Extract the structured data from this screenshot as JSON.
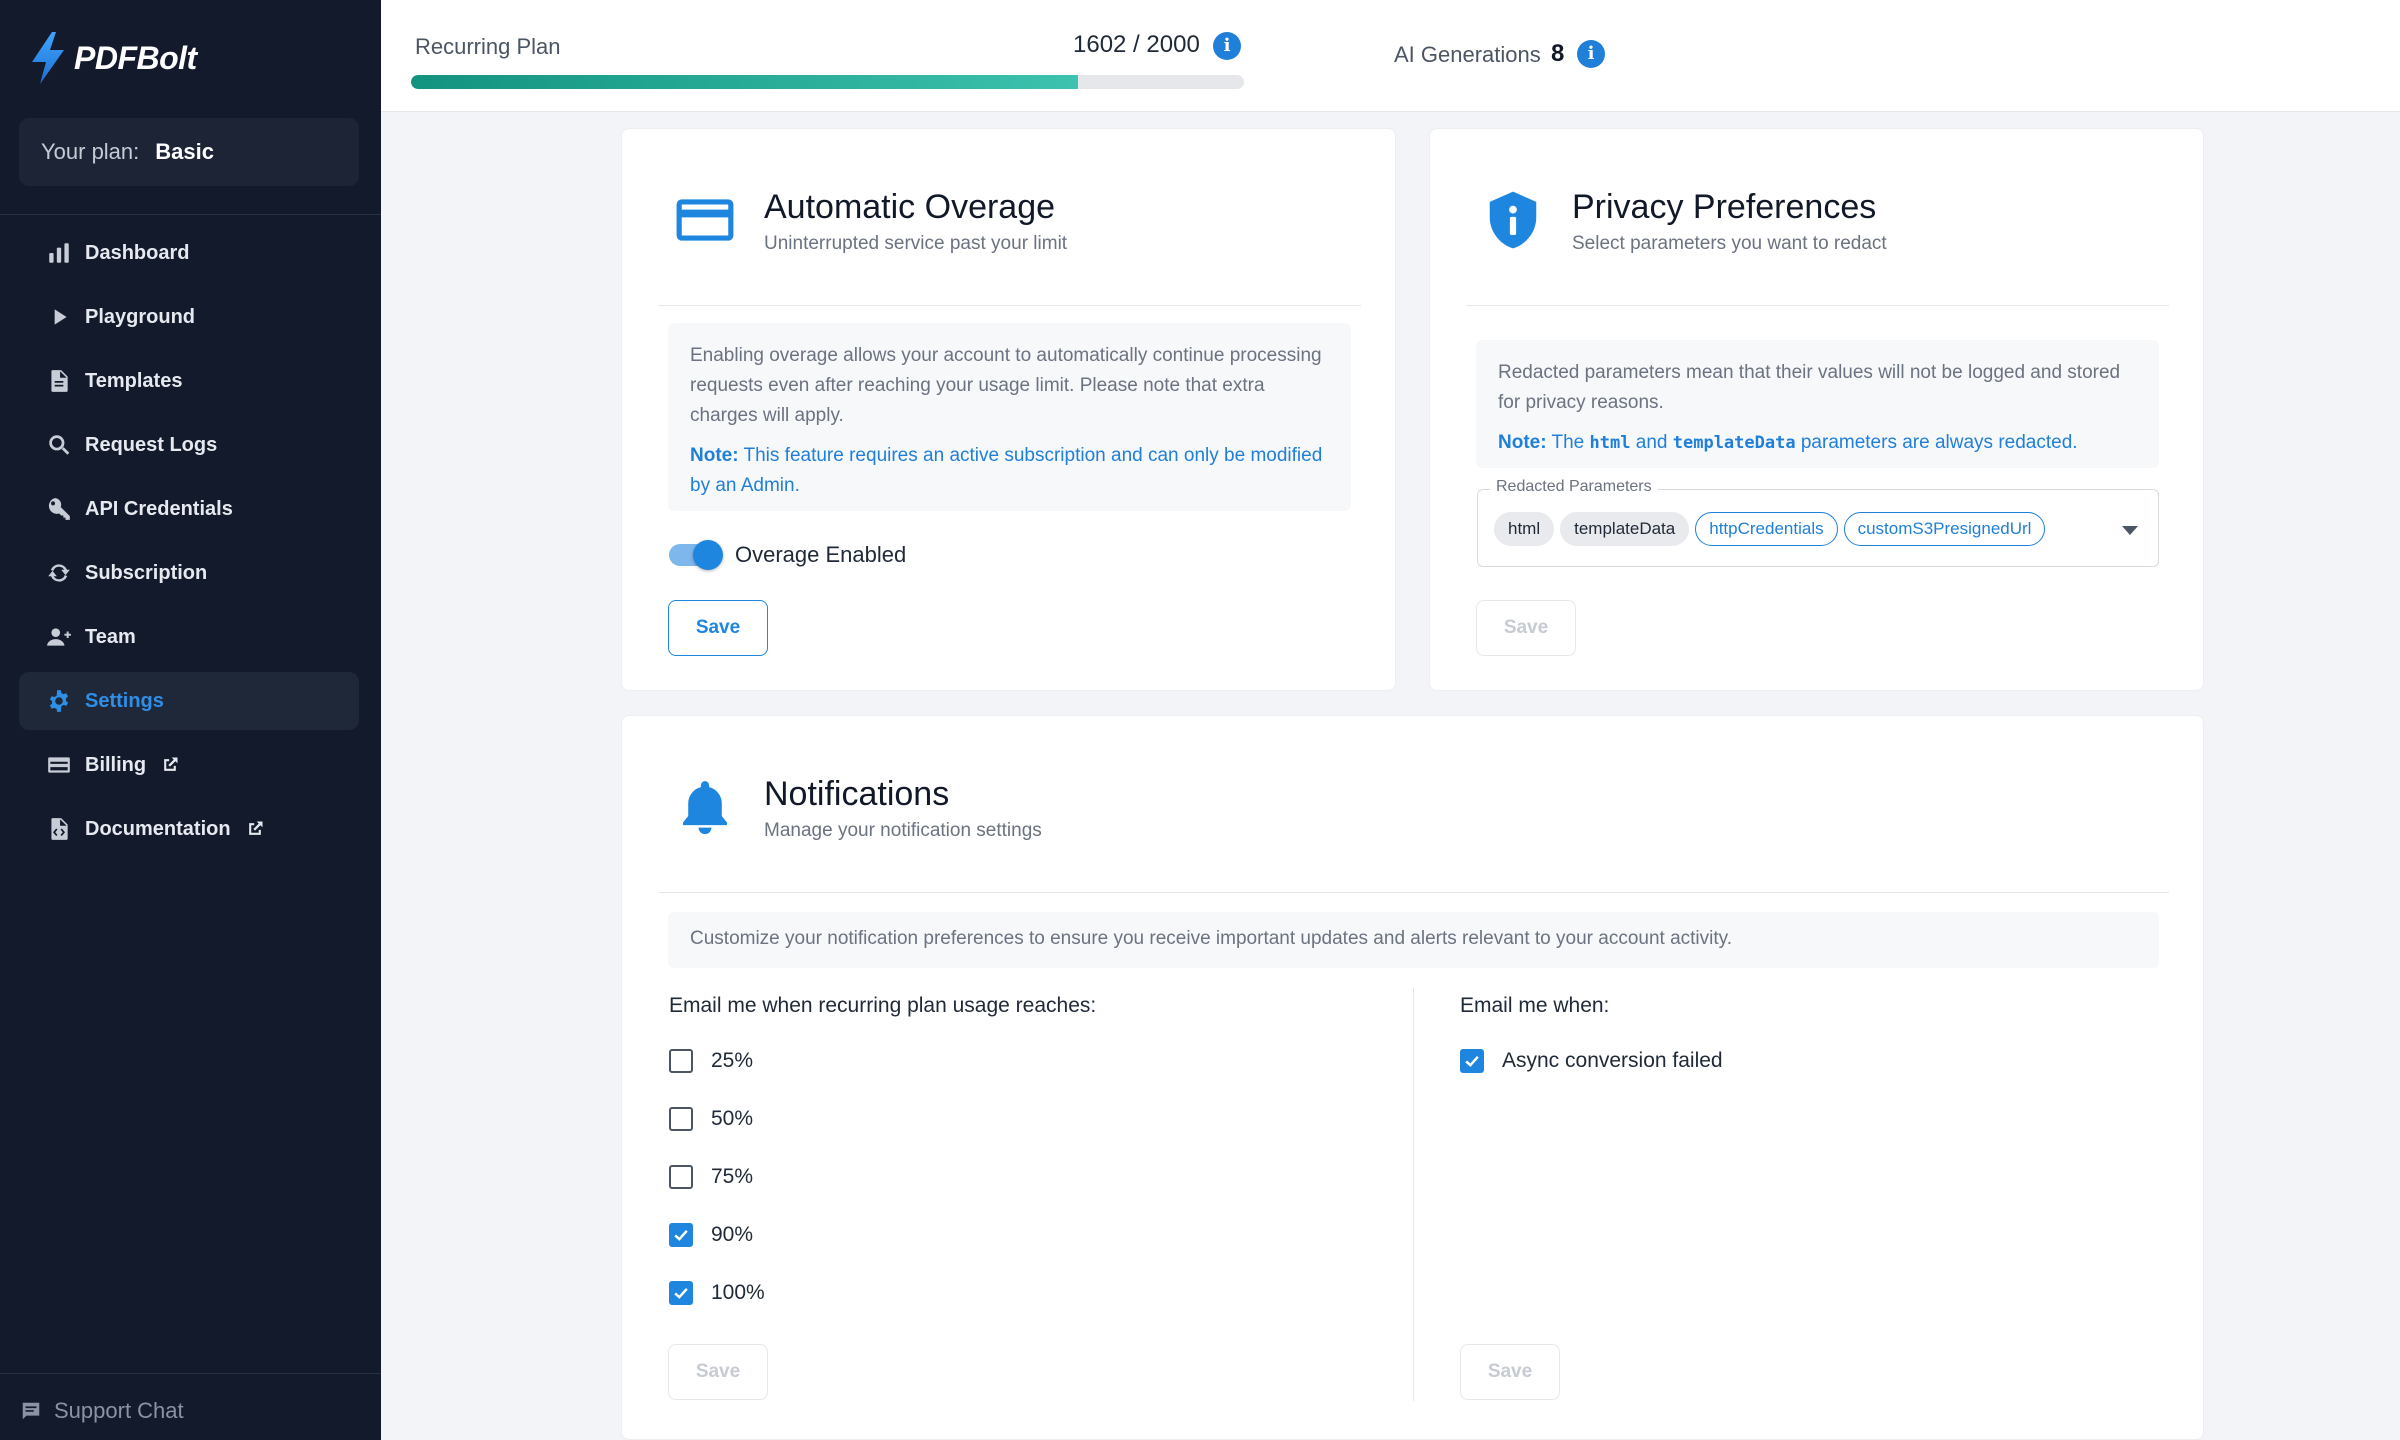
{
  "brand": {
    "name": "PDFBolt"
  },
  "plan": {
    "label": "Your plan:",
    "value": "Basic"
  },
  "nav": [
    {
      "label": "Dashboard",
      "icon": "bar-chart-icon"
    },
    {
      "label": "Playground",
      "icon": "play-icon"
    },
    {
      "label": "Templates",
      "icon": "document-icon"
    },
    {
      "label": "Request Logs",
      "icon": "search-icon"
    },
    {
      "label": "API Credentials",
      "icon": "key-icon"
    },
    {
      "label": "Subscription",
      "icon": "refresh-icon"
    },
    {
      "label": "Team",
      "icon": "team-icon"
    },
    {
      "label": "Settings",
      "icon": "gear-icon",
      "active": true
    },
    {
      "label": "Billing",
      "icon": "credit-card-icon",
      "external": true
    },
    {
      "label": "Documentation",
      "icon": "code-file-icon",
      "external": true
    }
  ],
  "support": {
    "label": "Support Chat"
  },
  "usage": {
    "recurring_label": "Recurring Plan",
    "recurring_count": "1602 / 2000",
    "recurring_used": 1602,
    "recurring_total": 2000,
    "ai_label": "AI Generations",
    "ai_count": "8"
  },
  "overage": {
    "title": "Automatic Overage",
    "subtitle": "Uninterrupted service past your limit",
    "description": "Enabling overage allows your account to automatically continue processing requests even after reaching your usage limit. Please note that extra charges will apply.",
    "note_label": "Note:",
    "note_text": "This feature requires an active subscription and can only be modified by an Admin.",
    "toggle_label": "Overage Enabled",
    "toggle_on": true,
    "save_label": "Save"
  },
  "privacy": {
    "title": "Privacy Preferences",
    "subtitle": "Select parameters you want to redact",
    "description": "Redacted parameters mean that their values will not be logged and stored for privacy reasons.",
    "note_label": "Note:",
    "note_pre": "The",
    "note_code1": "html",
    "note_mid": "and",
    "note_code2": "templateData",
    "note_post": "parameters are always redacted.",
    "field_label": "Redacted Parameters",
    "chips": [
      "html",
      "templateData",
      "httpCredentials",
      "customS3PresignedUrl"
    ],
    "save_label": "Save"
  },
  "notifications": {
    "title": "Notifications",
    "subtitle": "Manage your notification settings",
    "description": "Customize your notification preferences to ensure you receive important updates and alerts relevant to your account activity.",
    "usage_title": "Email me when recurring plan usage reaches:",
    "usage_options": [
      {
        "label": "25%",
        "checked": false
      },
      {
        "label": "50%",
        "checked": false
      },
      {
        "label": "75%",
        "checked": false
      },
      {
        "label": "90%",
        "checked": true
      },
      {
        "label": "100%",
        "checked": true
      }
    ],
    "events_title": "Email me when:",
    "event_options": [
      {
        "label": "Async conversion failed",
        "checked": true
      }
    ],
    "save_label": "Save"
  },
  "colors": {
    "accent": "#1f86e0",
    "sidebar": "#121a2b",
    "progress": "#12937f"
  }
}
